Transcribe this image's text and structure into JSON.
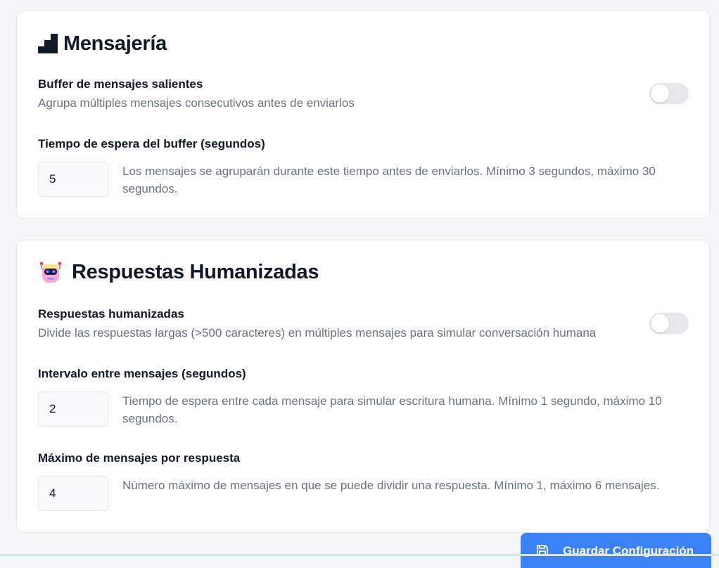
{
  "messaging": {
    "title": "Mensajería",
    "buffer": {
      "label": "Buffer de mensajes salientes",
      "description": "Agrupa múltiples mensajes consecutivos antes de enviarlos",
      "enabled": false
    },
    "wait_time": {
      "label": "Tiempo de espera del buffer (segundos)",
      "value": "5",
      "help": "Los mensajes se agruparán durante este tiempo antes de enviarlos. Mínimo 3 segundos, máximo 30 segundos."
    }
  },
  "humanized": {
    "title": "Respuestas Humanizadas",
    "toggle": {
      "label": "Respuestas humanizadas",
      "description": "Divide las respuestas largas (>500 caracteres) en múltiples mensajes para simular conversación humana",
      "enabled": false
    },
    "interval": {
      "label": "Intervalo entre mensajes (segundos)",
      "value": "2",
      "help": "Tiempo de espera entre cada mensaje para simular escritura humana. Mínimo 1 segundo, máximo 10 segundos."
    },
    "max_messages": {
      "label": "Máximo de mensajes por respuesta",
      "value": "4",
      "help": "Número máximo de mensajes en que se puede dividir una respuesta. Mínimo 1, máximo 6 mensajes."
    }
  },
  "save_button": {
    "label": "Guardar Configuración",
    "icon": "save-icon"
  },
  "icons": {
    "messaging": "stairs-icon",
    "humanized": "robot-icon"
  },
  "colors": {
    "accent": "#3b82f6",
    "toggle_off": "#e5e7eb",
    "muted_text": "#6b7280"
  }
}
